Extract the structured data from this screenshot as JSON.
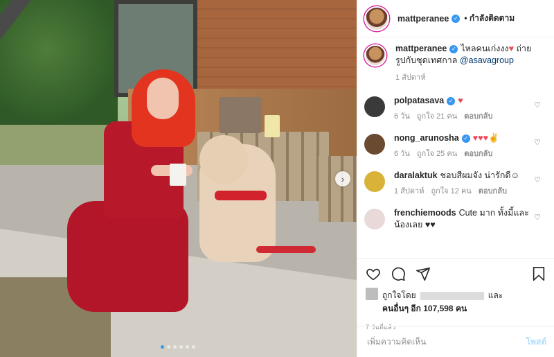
{
  "header": {
    "username": "mattperanee",
    "following_label": "• กำลังติดตาม"
  },
  "caption": {
    "username": "mattperanee",
    "text": "ไหลคนเก่งงง",
    "heart": "♥",
    "text2": " ถ่ายรูปกับชุดเทศกาล ",
    "mention": "@asavagroup",
    "time": "1 สัปดาห์"
  },
  "comments": [
    {
      "username": "polpatasava",
      "verified": true,
      "text": "♥",
      "time": "6 วัน",
      "likes": "ถูกใจ 21 คน",
      "reply": "ตอบกลับ",
      "avatar_color": "#3a3a3a"
    },
    {
      "username": "nong_arunosha",
      "verified": true,
      "text": "♥♥♥✌",
      "time": "6 วัน",
      "likes": "ถูกใจ 25 คน",
      "reply": "ตอบกลับ",
      "avatar_color": "#6b4a32"
    },
    {
      "username": "daralaktuk",
      "verified": false,
      "text": "ชอบสีผมจัง น่ารักดี☺",
      "time": "1 สัปดาห์",
      "likes": "ถูกใจ 12 คน",
      "reply": "ตอบกลับ",
      "avatar_color": "#d9b23a"
    },
    {
      "username": "frenchiemoods",
      "verified": false,
      "text": "Cute มาก ทั้งมี้และน้องเลย ♥♥",
      "time": "",
      "likes": "",
      "reply": "",
      "avatar_color": "#e9d9d9"
    }
  ],
  "likes": {
    "prefix": "ถูกใจโดย",
    "suffix": "และ",
    "others": "คนอื่นๆ อีก 107,598 คน"
  },
  "post_time": "7 วันที่แล้ว",
  "add_comment": {
    "placeholder": "เพิ่มความคิดเห็น",
    "post_label": "โพสต์"
  },
  "icons": [
    "heart-icon",
    "comment-icon",
    "share-icon",
    "bookmark-icon",
    "next-arrow-icon",
    "verified-icon"
  ]
}
